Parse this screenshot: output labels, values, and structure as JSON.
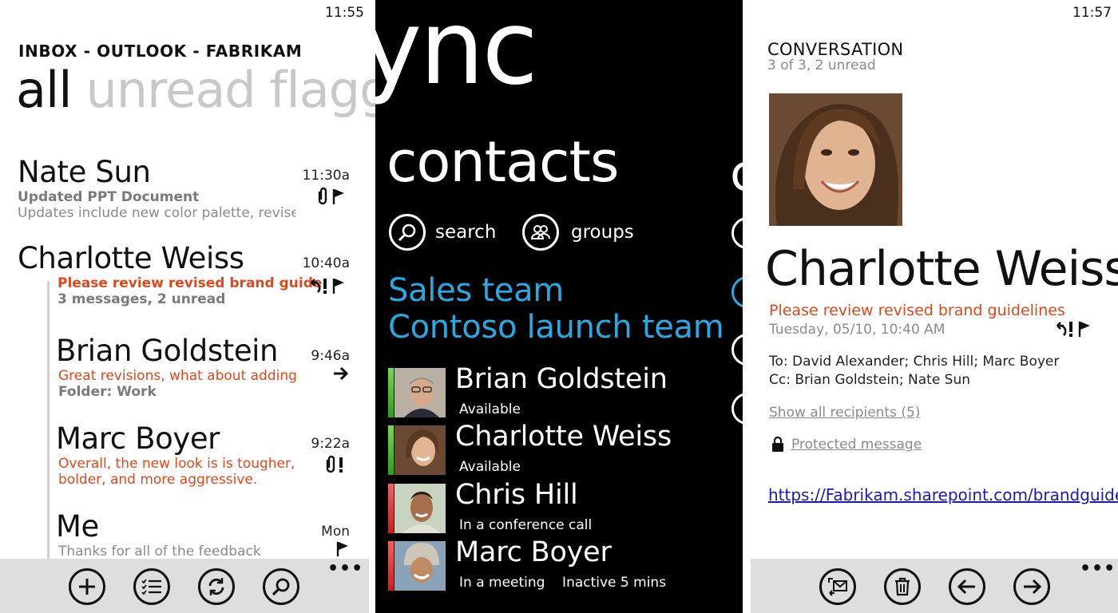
{
  "inbox": {
    "clock": "11:55",
    "title": "INBOX - OUTLOOK - FABRIKAM",
    "pivots": [
      "all",
      "unread",
      "flagg"
    ],
    "messages": [
      {
        "sender": "Nate Sun",
        "time": "11:30a",
        "subject": "Updated PPT Document",
        "preview": "Updates include new color palette, revised",
        "icons": "paperclip flag",
        "icon_glyphs": "𝟎⚑"
      },
      {
        "sender": "Charlotte Weiss",
        "time": "10:40a",
        "subject": "Please review revised brand guide",
        "preview": "3 messages, 2 unread",
        "icons": "reply-all important flag",
        "icon_glyphs": "↶!⚑"
      },
      {
        "sender": "Brian Goldstein",
        "time": "9:46a",
        "subject": "Great revisions, what about adding s",
        "preview": "Folder: Work",
        "icons": "forward",
        "icon_glyphs": "➔"
      },
      {
        "sender": "Marc Boyer",
        "time": "9:22a",
        "subject": "Overall, the new look is is tougher,",
        "preview": "bolder, and more aggressive.",
        "icons": "paperclip important",
        "icon_glyphs": "𝟎!"
      },
      {
        "sender": "Me",
        "time": "Mon",
        "subject": "",
        "preview": "Thanks for all of the feedback",
        "icons": "flag",
        "icon_glyphs": "⚑"
      }
    ],
    "appbar": {
      "new_glyph": "+",
      "select_glyph": "≡",
      "sync_glyph": "⟳",
      "search_glyph": "⌕",
      "more_glyph": "•••"
    }
  },
  "lync": {
    "title": "lync",
    "section": "contacts",
    "actions": {
      "search": "search",
      "groups": "groups"
    },
    "groups": [
      "Sales team",
      "Contoso launch team"
    ],
    "contacts": [
      {
        "name": "Brian Goldstein",
        "status": "Available",
        "presence_color": "#4cbd2b"
      },
      {
        "name": "Charlotte Weiss",
        "status": "Available",
        "presence_color": "#4cbd2b"
      },
      {
        "name": "Chris Hill",
        "status": "In a conference call",
        "presence_color": "#e03a3a"
      },
      {
        "name": "Marc Boyer",
        "status": "In a meeting    Inactive 5 mins",
        "presence_color": "#e03a3a"
      }
    ],
    "accent": "#27a9e1"
  },
  "conversation": {
    "clock": "11:57",
    "title": "CONVERSATION",
    "subtitle": "3 of 3, 2 unread",
    "sender": "Charlotte Weiss",
    "subject": "Please review revised brand guidelines",
    "date": "Tuesday, 05/10, 10:40 AM",
    "icons": "reply-all important flag",
    "icon_glyphs": "↶!⚑",
    "to": "To: David Alexander; Chris Hill; Marc Boyer",
    "cc": "Cc: Brian Goldstein; Nate Sun",
    "show_recipients": "Show all recipients (5)",
    "protected": "Protected message",
    "link": "https://Fabrikam.sharepoint.com/brandguide",
    "appbar": {
      "more_glyph": "•••"
    }
  }
}
